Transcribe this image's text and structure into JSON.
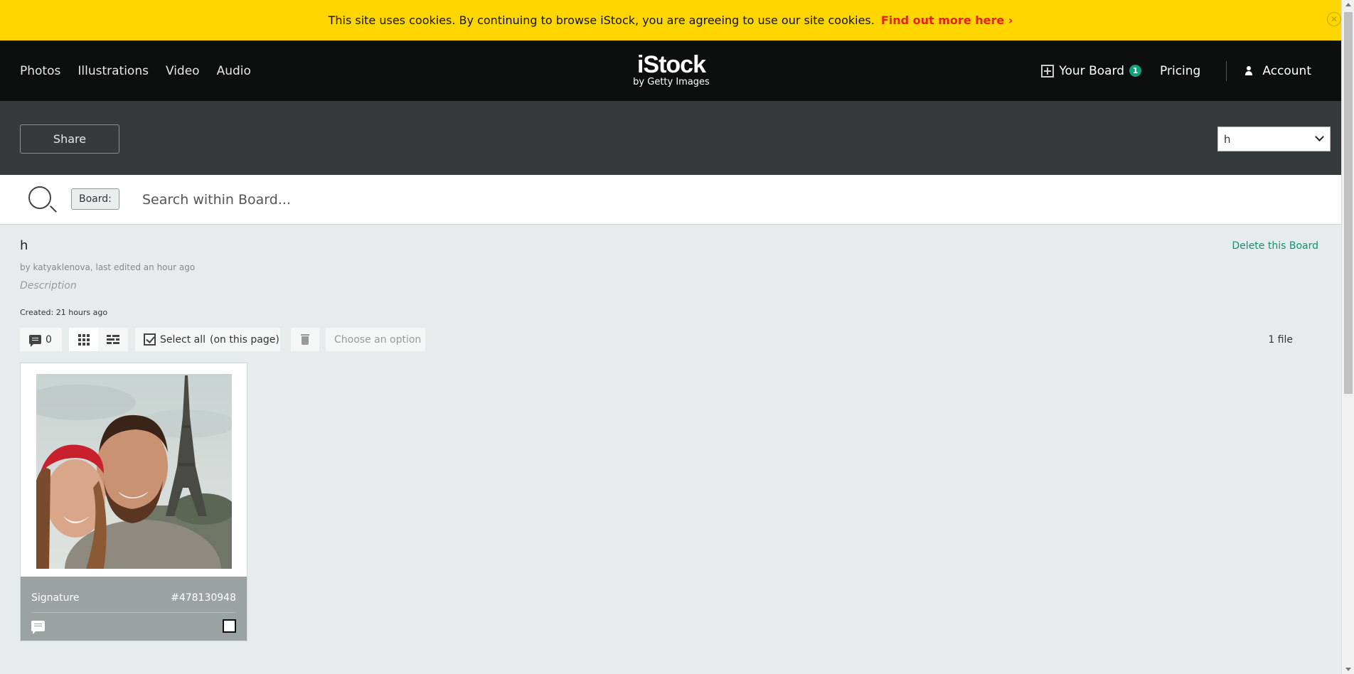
{
  "cookie_bar": {
    "message": "This site uses cookies. By continuing to browse iStock, you are agreeing to use our site cookies.",
    "link": "Find out more here ›",
    "close": "✕"
  },
  "header": {
    "nav": [
      "Photos",
      "Illustrations",
      "Video",
      "Audio"
    ],
    "logo": {
      "main": "iStock",
      "sub": "by Getty Images"
    },
    "board_label": "Your Board",
    "board_count": "1",
    "pricing": "Pricing",
    "account": "Account"
  },
  "toolbar": {
    "share": "Share",
    "board_select_value": "h"
  },
  "search": {
    "tag": "Board:",
    "placeholder": "Search within Board..."
  },
  "board": {
    "title": "h",
    "meta": "by katyaklenova, last edited an hour ago",
    "description": "Description",
    "created": "Created: 21 hours ago",
    "delete": "Delete this Board"
  },
  "actions": {
    "comment_count": "0",
    "select_all": "Select all",
    "select_all_suffix": "(on this page)",
    "choose_option": "Choose an option",
    "file_count": "1 file"
  },
  "card": {
    "license": "Signature",
    "asset_id": "#478130948"
  },
  "colors": {
    "cookie_bg": "#ffd600",
    "cookie_link": "#e8201a",
    "header_bg": "#0d0f0f",
    "toolbar_bg": "#353a3b",
    "accent_green": "#12a17a",
    "page_bg": "#e6ecec"
  }
}
